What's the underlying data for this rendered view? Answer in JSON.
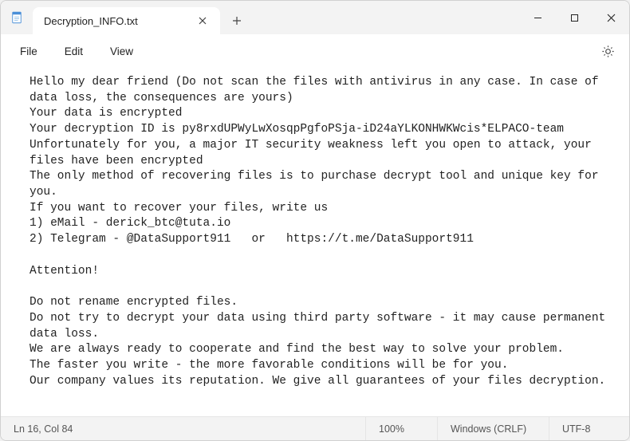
{
  "app": {
    "tab_title": "Decryption_INFO.txt"
  },
  "menu": {
    "file": "File",
    "edit": "Edit",
    "view": "View"
  },
  "content": "Hello my dear friend (Do not scan the files with antivirus in any case. In case of data loss, the consequences are yours)\nYour data is encrypted\nYour decryption ID is py8rxdUPWyLwXosqpPgfoPSja-iD24aYLKONHWKWcis*ELPACO-team\nUnfortunately for you, a major IT security weakness left you open to attack, your files have been encrypted\nThe only method of recovering files is to purchase decrypt tool and unique key for you.\nIf you want to recover your files, write us\n1) eMail - derick_btc@tuta.io\n2) Telegram - @DataSupport911   or   https://t.me/DataSupport911\n\nAttention!\n\nDo not rename encrypted files.\nDo not try to decrypt your data using third party software - it may cause permanent data loss.\nWe are always ready to cooperate and find the best way to solve your problem.\nThe faster you write - the more favorable conditions will be for you.\nOur company values its reputation. We give all guarantees of your files decryption.",
  "status": {
    "position": "Ln 16, Col 84",
    "zoom": "100%",
    "encoding": "Windows (CRLF)",
    "charset": "UTF-8"
  }
}
